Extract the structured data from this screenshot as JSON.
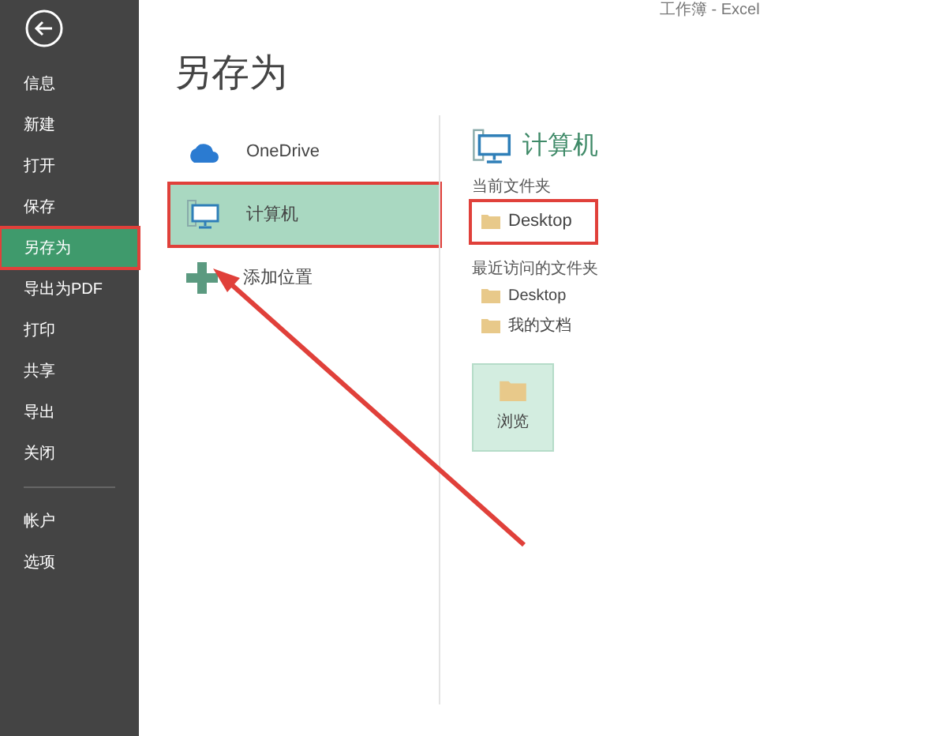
{
  "window": {
    "title": "工作簿 - Excel"
  },
  "sidebar": {
    "items": [
      {
        "label": "信息",
        "selected": false,
        "highlighted": false
      },
      {
        "label": "新建",
        "selected": false,
        "highlighted": false
      },
      {
        "label": "打开",
        "selected": false,
        "highlighted": false
      },
      {
        "label": "保存",
        "selected": false,
        "highlighted": false
      },
      {
        "label": "另存为",
        "selected": true,
        "highlighted": true
      },
      {
        "label": "导出为PDF",
        "selected": false,
        "highlighted": false
      },
      {
        "label": "打印",
        "selected": false,
        "highlighted": false
      },
      {
        "label": "共享",
        "selected": false,
        "highlighted": false
      },
      {
        "label": "导出",
        "selected": false,
        "highlighted": false
      },
      {
        "label": "关闭",
        "selected": false,
        "highlighted": false
      }
    ],
    "bottom_items": [
      {
        "label": "帐户"
      },
      {
        "label": "选项"
      }
    ]
  },
  "page_title": "另存为",
  "places": [
    {
      "kind": "cloud",
      "label": "OneDrive",
      "selected": false,
      "highlighted": false
    },
    {
      "kind": "computer",
      "label": "计算机",
      "selected": true,
      "highlighted": true
    },
    {
      "kind": "add",
      "label": "添加位置",
      "selected": false,
      "highlighted": false
    }
  ],
  "detail": {
    "title": "计算机",
    "current_heading": "当前文件夹",
    "current": [
      {
        "label": "Desktop",
        "highlighted": true
      }
    ],
    "recent_heading": "最近访问的文件夹",
    "recent": [
      {
        "label": "Desktop"
      },
      {
        "label": "我的文档"
      }
    ],
    "browse": "浏览"
  }
}
